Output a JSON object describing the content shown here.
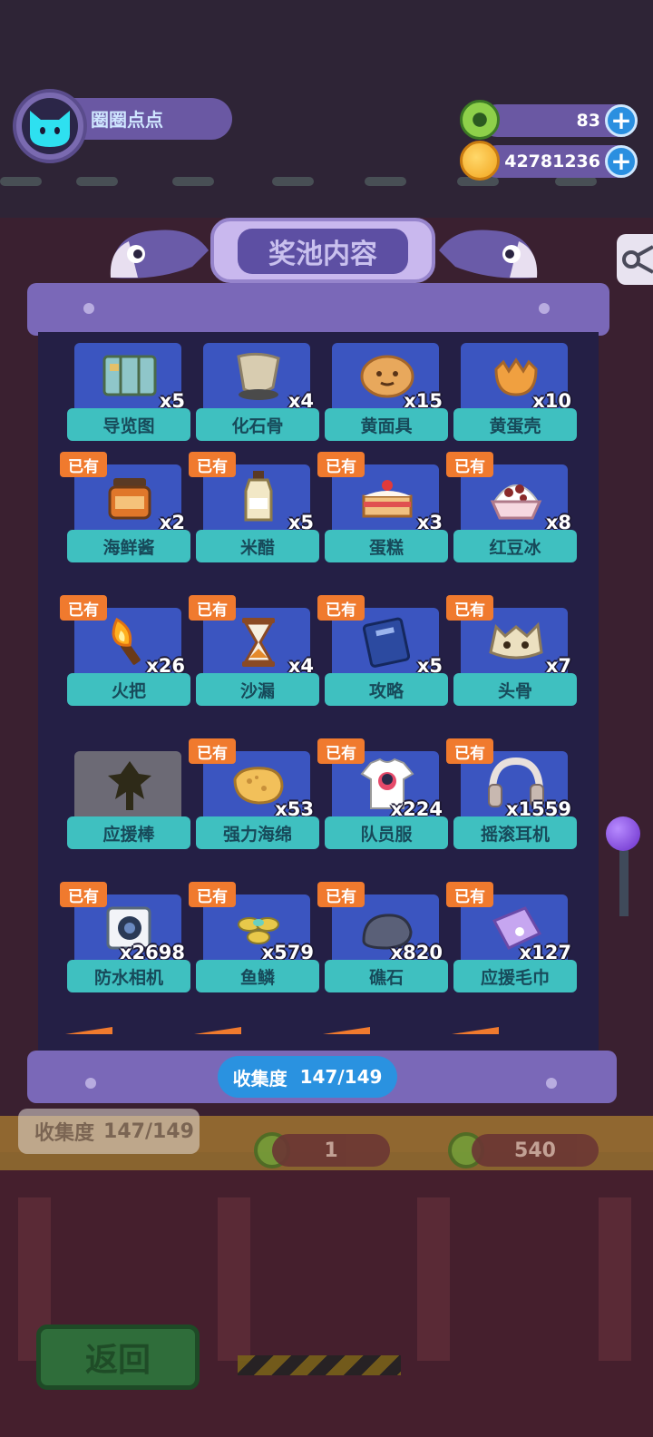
{
  "player": {
    "name": "圈圈点点"
  },
  "currencies": [
    {
      "icon": "green-donut-icon",
      "value": "83"
    },
    {
      "icon": "gold-planet-coin-icon",
      "value": "42781236"
    }
  ],
  "dialog": {
    "title": "奖池内容",
    "collection_label": "收集度",
    "collection_value": "147/149",
    "owned_badge": "已有"
  },
  "items": [
    {
      "name": "导览图",
      "count": "x5",
      "owned": false,
      "icon": "map-icon"
    },
    {
      "name": "化石骨",
      "count": "x4",
      "owned": false,
      "icon": "fossil-bone-icon"
    },
    {
      "name": "黄面具",
      "count": "x15",
      "owned": false,
      "icon": "yellow-mask-icon"
    },
    {
      "name": "黄蛋壳",
      "count": "x10",
      "owned": false,
      "icon": "eggshell-icon"
    },
    {
      "name": "海鲜酱",
      "count": "x2",
      "owned": true,
      "icon": "sauce-jar-icon"
    },
    {
      "name": "米醋",
      "count": "x5",
      "owned": true,
      "icon": "vinegar-bottle-icon"
    },
    {
      "name": "蛋糕",
      "count": "x3",
      "owned": true,
      "icon": "cake-icon"
    },
    {
      "name": "红豆冰",
      "count": "x8",
      "owned": true,
      "icon": "shaved-ice-icon"
    },
    {
      "name": "火把",
      "count": "x26",
      "owned": true,
      "icon": "torch-icon"
    },
    {
      "name": "沙漏",
      "count": "x4",
      "owned": true,
      "icon": "hourglass-icon"
    },
    {
      "name": "攻略",
      "count": "x5",
      "owned": true,
      "icon": "guide-book-icon"
    },
    {
      "name": "头骨",
      "count": "x7",
      "owned": true,
      "icon": "skull-icon"
    },
    {
      "name": "应援棒",
      "count": "",
      "owned": false,
      "locked": true,
      "icon": "glow-stick-icon"
    },
    {
      "name": "强力海绵",
      "count": "x53",
      "owned": true,
      "icon": "sponge-icon"
    },
    {
      "name": "队员服",
      "count": "x224",
      "owned": true,
      "icon": "tshirt-icon"
    },
    {
      "name": "摇滚耳机",
      "count": "x1559",
      "owned": true,
      "icon": "headphones-icon"
    },
    {
      "name": "防水相机",
      "count": "x2698",
      "owned": true,
      "icon": "camera-icon"
    },
    {
      "name": "鱼鳞",
      "count": "x579",
      "owned": true,
      "icon": "fish-scale-icon"
    },
    {
      "name": "礁石",
      "count": "x820",
      "owned": true,
      "icon": "rock-icon"
    },
    {
      "name": "应援毛巾",
      "count": "x127",
      "owned": true,
      "icon": "towel-icon"
    }
  ],
  "background": {
    "collection_label": "收集度",
    "collection_value": "147/149",
    "pill_left": "1",
    "pill_right": "540",
    "back_button": "返回"
  }
}
